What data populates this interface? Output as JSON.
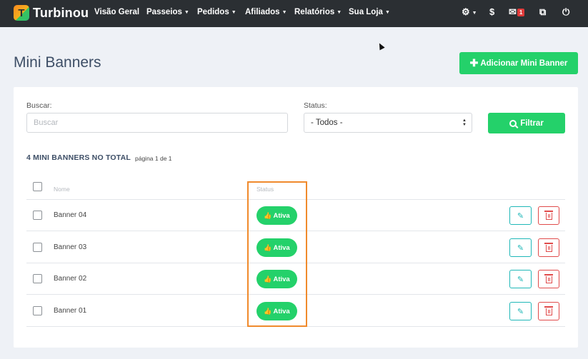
{
  "app": {
    "name": "Turbinou",
    "logo_letter": "T",
    "colors": {
      "accent": "#24d16a",
      "navbar": "#2b2f33",
      "edit": "#1fb7b8",
      "delete": "#e04a4a",
      "highlight": "#f08a2c"
    }
  },
  "navbar": {
    "items": [
      {
        "label": "Visão Geral",
        "dropdown": false
      },
      {
        "label": "Passeios",
        "dropdown": true
      },
      {
        "label": "Pedidos",
        "dropdown": true
      },
      {
        "label": "Afiliados",
        "dropdown": true
      },
      {
        "label": "Relatórios",
        "dropdown": true
      },
      {
        "label": "Sua Loja",
        "dropdown": true
      }
    ],
    "right": {
      "settings_icon": "gear-icon",
      "currency_symbol": "$",
      "mail_icon": "envelope-icon",
      "mail_badge": "1",
      "external_icon": "external-link-icon",
      "power_icon": "power-icon"
    }
  },
  "header": {
    "title": "Mini Banners",
    "add_button_label": "Adicionar Mini Banner",
    "add_button_icon": "plus-icon"
  },
  "filters": {
    "search_label": "Buscar:",
    "search_placeholder": "Buscar",
    "search_value": "",
    "status_label": "Status:",
    "status_selected": "- Todos -",
    "filter_button_label": "Filtrar",
    "filter_button_icon": "search-icon"
  },
  "summary": {
    "total_text": "4 MINI BANNERS NO TOTAL",
    "page_text": "página 1 de 1"
  },
  "table": {
    "columns": [
      "Nome",
      "Status"
    ],
    "rows": [
      {
        "name": "Banner 04",
        "status": "Ativa"
      },
      {
        "name": "Banner 03",
        "status": "Ativa"
      },
      {
        "name": "Banner 02",
        "status": "Ativa"
      },
      {
        "name": "Banner 01",
        "status": "Ativa"
      }
    ],
    "status_icon": "thumbs-up-icon",
    "edit_icon": "pencil-icon",
    "delete_icon": "trash-icon"
  }
}
